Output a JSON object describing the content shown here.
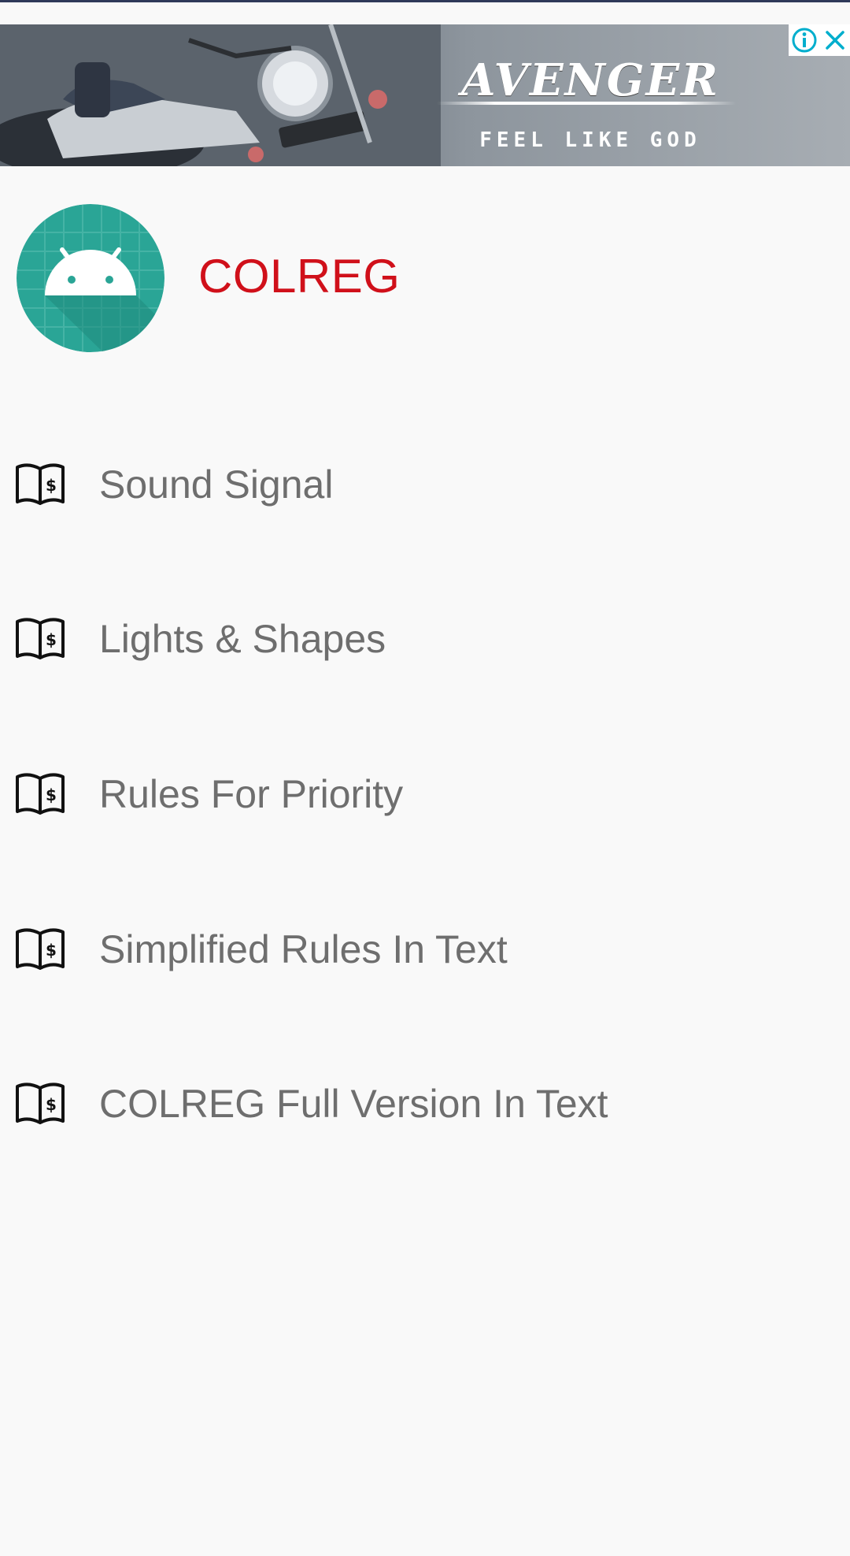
{
  "ad": {
    "headline": "AVENGER",
    "tagline": "FEEL LIKE GOD",
    "info_icon": "info-icon",
    "close_icon": "close-icon"
  },
  "header": {
    "title": "COLREG",
    "logo_icon": "android-logo-icon"
  },
  "menu": {
    "items": [
      {
        "label": "Sound Signal",
        "icon": "book-icon"
      },
      {
        "label": "Lights & Shapes",
        "icon": "book-icon"
      },
      {
        "label": "Rules For Priority",
        "icon": "book-icon"
      },
      {
        "label": "Simplified Rules In Text",
        "icon": "book-icon"
      },
      {
        "label": "COLREG Full Version In Text",
        "icon": "book-icon"
      }
    ]
  },
  "colors": {
    "title": "#d0101a",
    "menu_text": "#6e6e6e",
    "background": "#f9f9f9",
    "logo_teal": "#2aa596"
  }
}
